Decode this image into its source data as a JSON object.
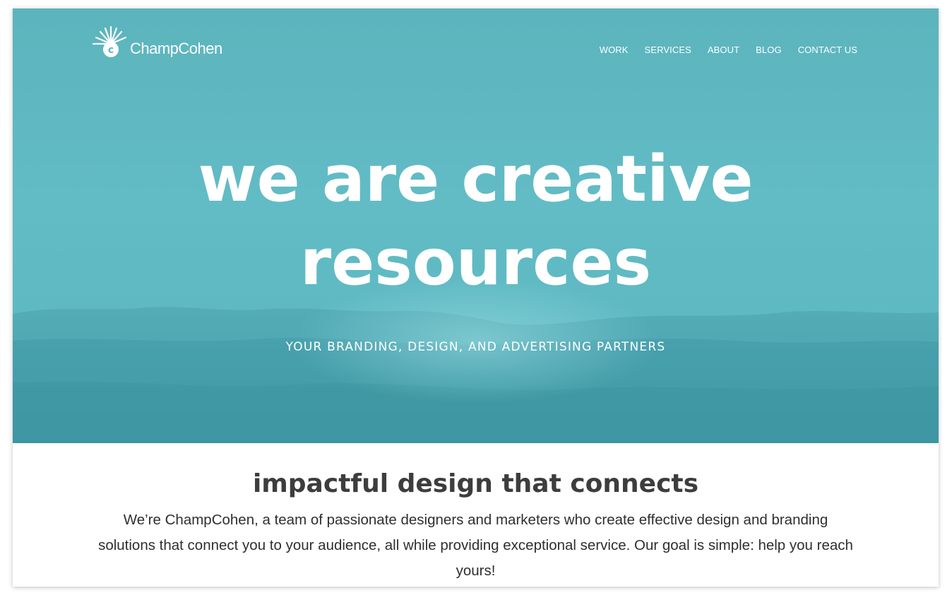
{
  "brand": {
    "name": "ChampCohen",
    "logo_icon": "sunburst-c-logo"
  },
  "nav": {
    "items": [
      {
        "label": "WORK"
      },
      {
        "label": "SERVICES"
      },
      {
        "label": "ABOUT"
      },
      {
        "label": "BLOG"
      },
      {
        "label": "CONTACT US"
      }
    ]
  },
  "hero": {
    "headline_line1": "we are creative",
    "headline_line2": "resources",
    "tagline": "YOUR BRANDING, DESIGN, AND ADVERTISING PARTNERS",
    "background_color": "#5fb8c1",
    "background_image": "ocean-waves"
  },
  "intro": {
    "heading": "impactful design that connects",
    "body": "We’re ChampCohen, a team of passionate designers and marketers who create effective design and branding solutions that connect you to your audience, all while providing exceptional service. Our goal is simple: help you reach yours!"
  },
  "colors": {
    "hero_teal": "#5fb8c1",
    "text_dark": "#3d3d3d",
    "white": "#ffffff"
  }
}
